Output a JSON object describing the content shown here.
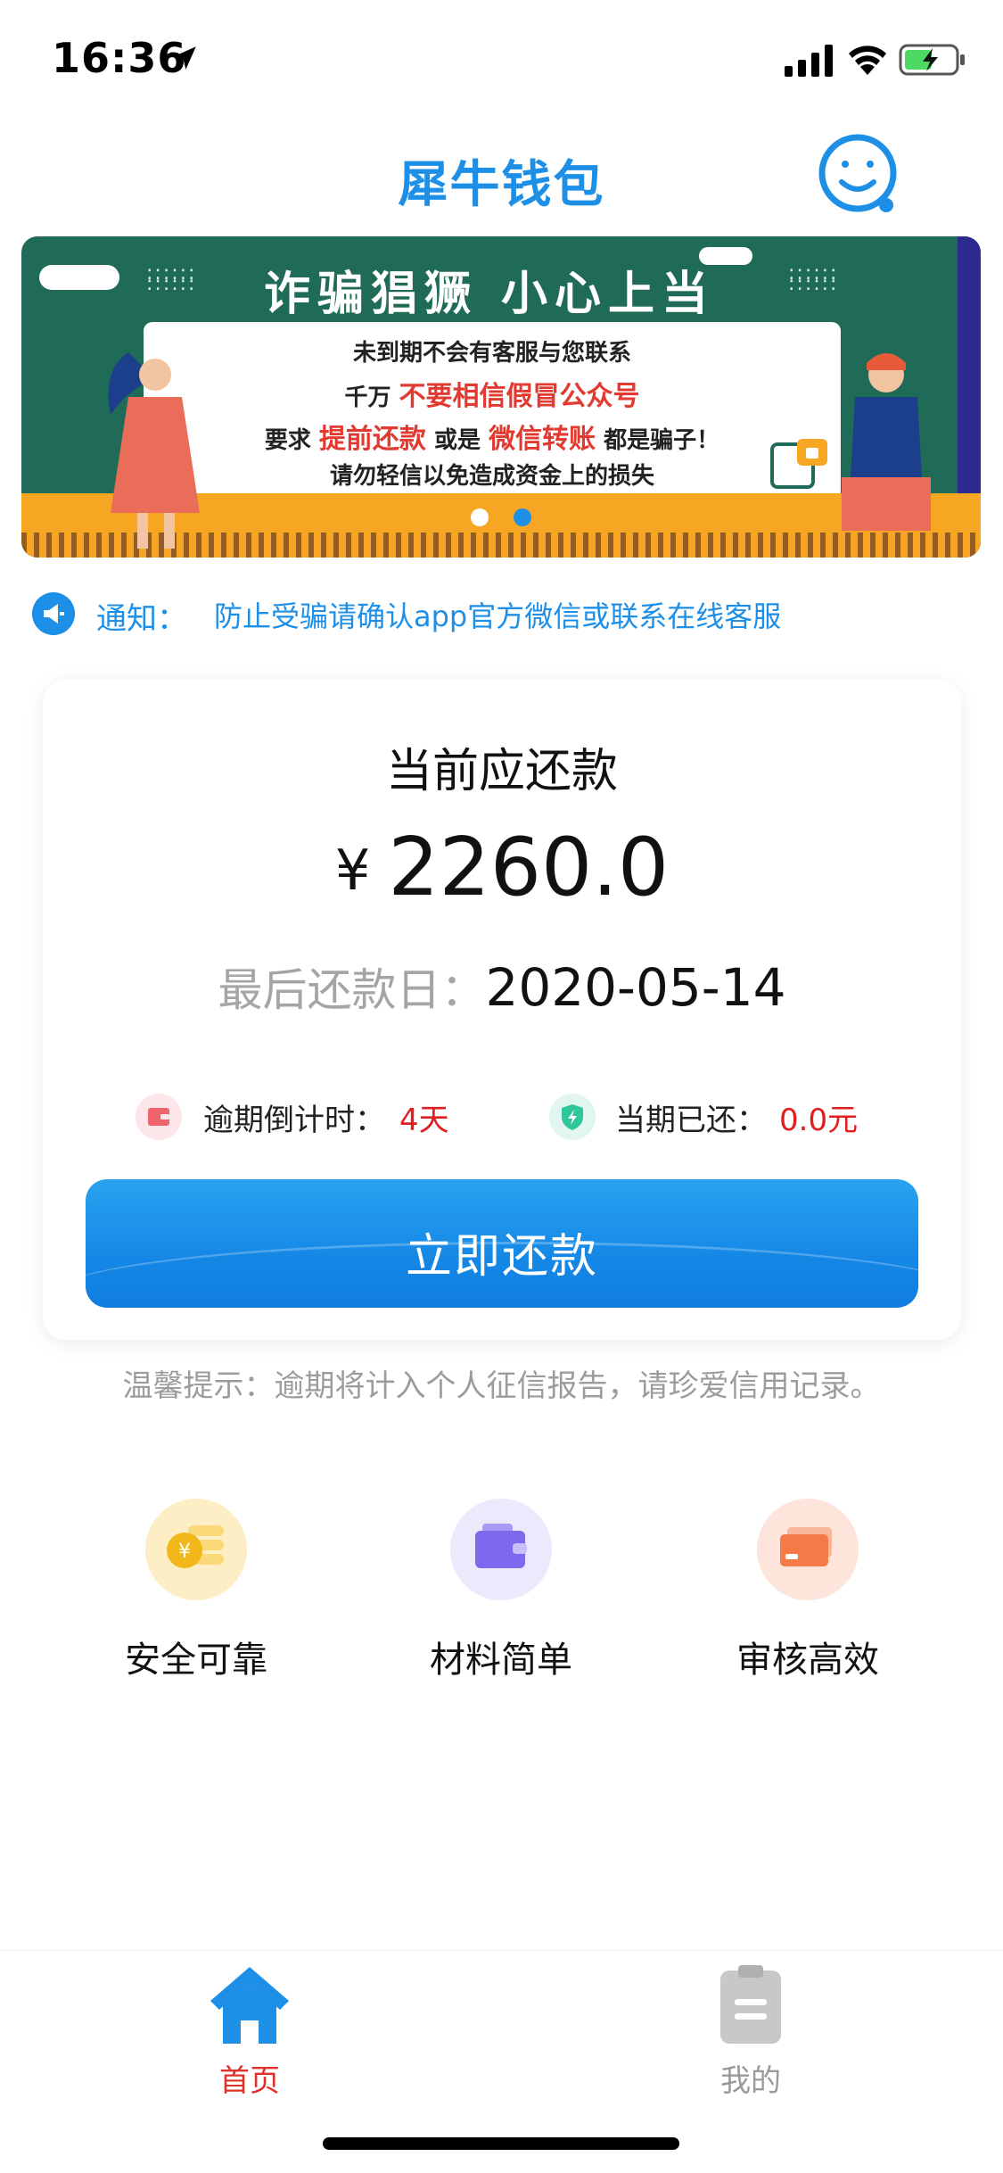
{
  "status_bar": {
    "time": "16:36"
  },
  "header": {
    "title": "犀牛钱包"
  },
  "banner": {
    "title": "诈骗猖獗 小心上当",
    "line1": "未到期不会有客服与您联系",
    "line2_prefix": "千万",
    "line2_red": "不要相信假冒公众号",
    "line3_prefix": "要求",
    "line3_red1": "提前还款",
    "line3_mid": "或是",
    "line3_red2": "微信转账",
    "line3_suffix": "都是骗子！",
    "line4": "请勿轻信以免造成资金上的损失"
  },
  "notice": {
    "label": "通知：",
    "text": "防止受骗请确认app官方微信或联系在线客服"
  },
  "repayment": {
    "title": "当前应还款",
    "currency": "¥",
    "amount": "2260.0",
    "due_label": "最后还款日：",
    "due_date": "2020-05-14",
    "overdue_label": "逾期倒计时：",
    "overdue_value": "4天",
    "paid_label": "当期已还：",
    "paid_value": "0.0元",
    "button_label": "立即还款"
  },
  "tip": "温馨提示：逾期将计入个人征信报告，请珍爱信用记录。",
  "features": [
    {
      "label": "安全可靠",
      "icon": "coin-stack-icon"
    },
    {
      "label": "材料简单",
      "icon": "wallet-icon"
    },
    {
      "label": "审核高效",
      "icon": "card-icon"
    }
  ],
  "tabs": [
    {
      "label": "首页",
      "icon": "home-icon",
      "active": true
    },
    {
      "label": "我的",
      "icon": "clipboard-icon",
      "active": false
    }
  ],
  "colors": {
    "brand_blue": "#1e8fe6",
    "alert_red": "#e11d1d",
    "active_tab": "#e0302a"
  }
}
